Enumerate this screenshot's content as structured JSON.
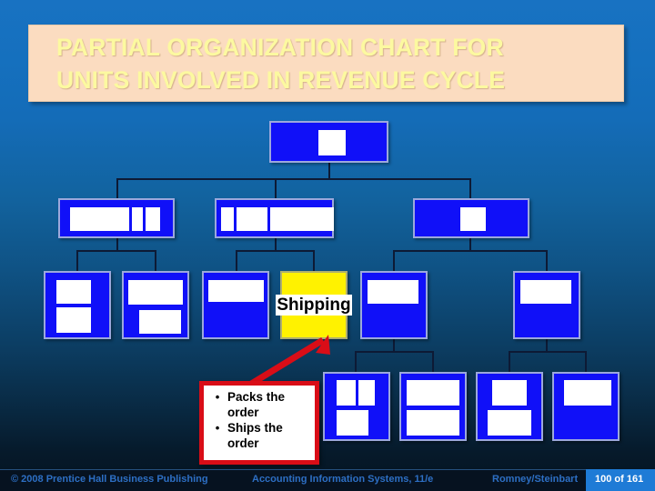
{
  "slide": {
    "title": "PARTIAL ORGANIZATION CHART FOR\nUNITS INVOLVED IN REVENUE CYCLE",
    "title_bg": "#FBDCC0",
    "title_color": "#FCF9A0",
    "background_top": "#1872C2",
    "background_bottom": "#041320"
  },
  "chart": {
    "box_fill": "#1010F8",
    "box_border": "#9CA8DC",
    "connector_color": "#0D1A35",
    "highlight": {
      "label": "Shipping",
      "fill": "#FFF200",
      "text_color": "#000000"
    },
    "nodes": [
      {
        "id": "root",
        "level": 1,
        "label": "",
        "redacted": true
      },
      {
        "id": "n2a",
        "level": 2,
        "label": "",
        "redacted": true
      },
      {
        "id": "n2b",
        "level": 2,
        "label": "",
        "redacted": true
      },
      {
        "id": "n2c",
        "level": 2,
        "label": "",
        "redacted": true
      },
      {
        "id": "n3a",
        "level": 3,
        "label": "",
        "redacted": true
      },
      {
        "id": "n3b",
        "level": 3,
        "label": "",
        "redacted": true
      },
      {
        "id": "n3c",
        "level": 3,
        "label": "",
        "redacted": true
      },
      {
        "id": "n3d",
        "level": 3,
        "label": "Shipping",
        "redacted": false
      },
      {
        "id": "n3e",
        "level": 3,
        "label": "",
        "redacted": true
      },
      {
        "id": "n3f",
        "level": 3,
        "label": "",
        "redacted": true
      },
      {
        "id": "n4a",
        "level": 4,
        "label": "",
        "redacted": true
      },
      {
        "id": "n4b",
        "level": 4,
        "label": "",
        "redacted": true
      },
      {
        "id": "n4c",
        "level": 4,
        "label": "",
        "redacted": true
      },
      {
        "id": "n4d",
        "level": 4,
        "label": "",
        "redacted": true
      }
    ]
  },
  "callout": {
    "border_color": "#D90D17",
    "bullet": "•",
    "items": [
      "Packs the order",
      "Ships the order"
    ]
  },
  "footer": {
    "copyright": "© 2008 Prentice Hall Business Publishing",
    "book": "Accounting Information Systems, 11/e",
    "authors": "Romney/Steinbart",
    "page": "100 of 161",
    "text_color": "#2D6FC4",
    "chip_color": "#1E7BD6"
  }
}
